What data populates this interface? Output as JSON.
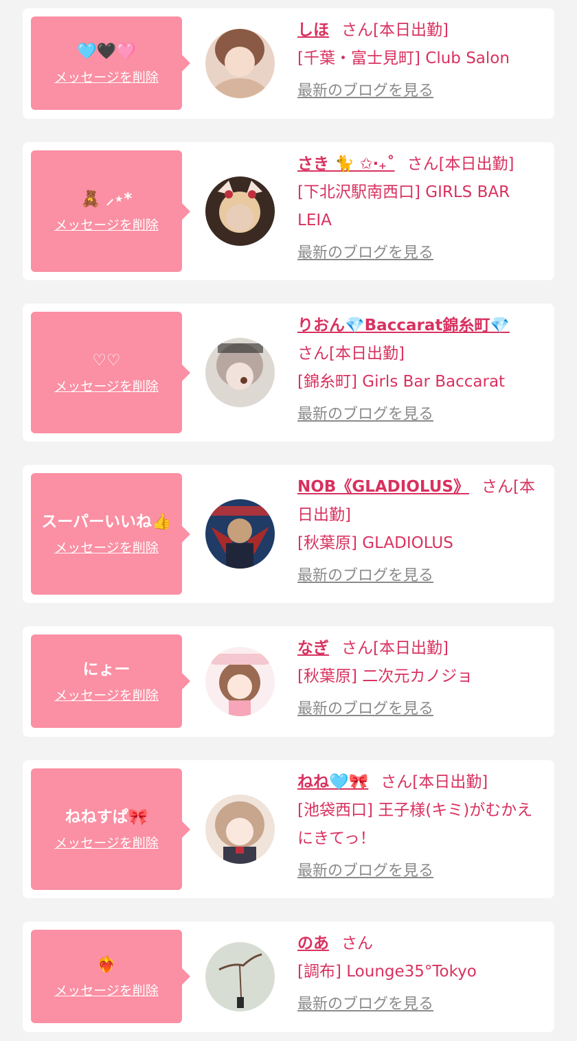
{
  "items": [
    {
      "message": "🩵🖤🩷",
      "delete": "メッセージを削除",
      "name": "しほ",
      "suffix": "さん[本日出勤]",
      "shop": "[千葉・富士見町] Club Salon",
      "blog": "最新のブログを見る"
    },
    {
      "message": "🧸 ⸝⋆*",
      "delete": "メッセージを削除",
      "name": "さき 🐈 ✩‧₊˚",
      "suffix": "さん[本日出勤]",
      "shop": "[下北沢駅南西口] GIRLS BAR LEIA",
      "blog": "最新のブログを見る"
    },
    {
      "message": "♡♡",
      "delete": "メッセージを削除",
      "name": "りおん💎Baccarat錦糸町💎",
      "suffix": "さん[本日出勤]",
      "shop": "[錦糸町] Girls Bar Baccarat",
      "blog": "最新のブログを見る"
    },
    {
      "message": "スーパーいいね👍",
      "delete": "メッセージを削除",
      "name": "NOB《GLADIOLUS》",
      "suffix": "さん[本日出勤]",
      "shop": "[秋葉原] GLADIOLUS",
      "blog": "最新のブログを見る"
    },
    {
      "message": "にょー",
      "delete": "メッセージを削除",
      "name": "なぎ",
      "suffix": "さん[本日出勤]",
      "shop": "[秋葉原] 二次元カノジョ",
      "blog": "最新のブログを見る"
    },
    {
      "message": "ねねすぱ🎀",
      "delete": "メッセージを削除",
      "name": "ねね🩵🎀",
      "suffix": "さん[本日出勤]",
      "shop": "[池袋西口] 王子様(キミ)がむかえにきてっ！",
      "blog": "最新のブログを見る"
    },
    {
      "message": "❤️‍🔥",
      "delete": "メッセージを削除",
      "name": "のあ",
      "suffix": "さん",
      "shop": "[調布] Lounge35°Tokyo",
      "blog": "最新のブログを見る"
    }
  ],
  "avatars": [
    {
      "icon": "profile-photo",
      "bg": "#e9d3c6",
      "fg": "#8a5a44"
    },
    {
      "icon": "profile-photo",
      "bg": "#3a2a22",
      "fg": "#e8cdb8"
    },
    {
      "icon": "profile-photo",
      "bg": "#ded8d2",
      "fg": "#b7a7a0"
    },
    {
      "icon": "profile-photo",
      "bg": "#1f3b66",
      "fg": "#c6a07a"
    },
    {
      "icon": "profile-photo",
      "bg": "#fbeef0",
      "fg": "#9b6a52"
    },
    {
      "icon": "profile-photo",
      "bg": "#efe3da",
      "fg": "#c8a68e"
    },
    {
      "icon": "profile-photo",
      "bg": "#d8ddd3",
      "fg": "#4a3a30"
    }
  ],
  "colors": {
    "bubble": "#fb8fa3",
    "accent": "#d8315f",
    "muted": "#8a8a8a",
    "background": "#f3f3f3"
  }
}
